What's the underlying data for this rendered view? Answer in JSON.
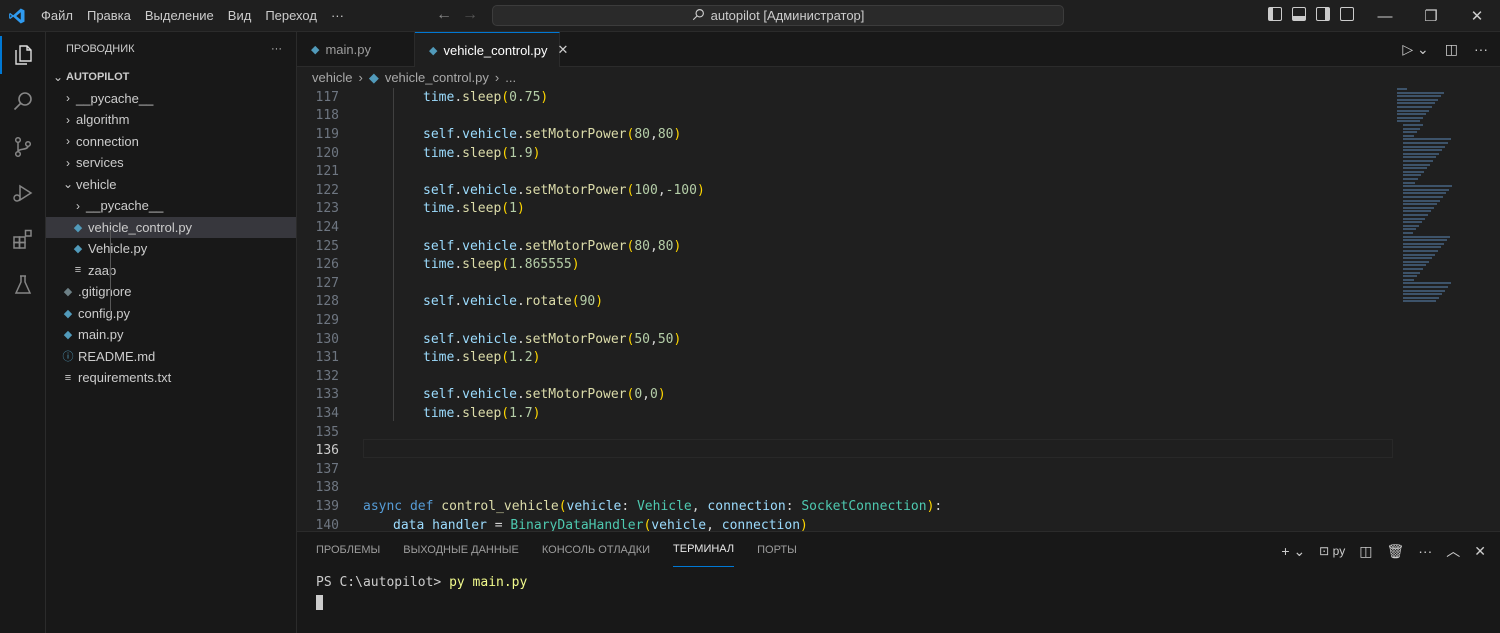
{
  "menu": [
    "Файл",
    "Правка",
    "Выделение",
    "Вид",
    "Переход",
    "···"
  ],
  "command_center": "autopilot [Администратор]",
  "explorer": {
    "title": "ПРОВОДНИК",
    "more": "···",
    "root": "AUTOPILOT",
    "items": [
      {
        "label": "__pycache__",
        "kind": "folder",
        "depth": 1
      },
      {
        "label": "algorithm",
        "kind": "folder",
        "depth": 1
      },
      {
        "label": "connection",
        "kind": "folder",
        "depth": 1
      },
      {
        "label": "services",
        "kind": "folder",
        "depth": 1
      },
      {
        "label": "vehicle",
        "kind": "folder-open",
        "depth": 1
      },
      {
        "label": "__pycache__",
        "kind": "folder",
        "depth": 2
      },
      {
        "label": "vehicle_control.py",
        "kind": "python",
        "depth": 2,
        "selected": true
      },
      {
        "label": "Vehicle.py",
        "kind": "python",
        "depth": 2
      },
      {
        "label": "zaap",
        "kind": "text",
        "depth": 2
      },
      {
        "label": ".gitignore",
        "kind": "git",
        "depth": 1
      },
      {
        "label": "config.py",
        "kind": "python",
        "depth": 1
      },
      {
        "label": "main.py",
        "kind": "python",
        "depth": 1
      },
      {
        "label": "README.md",
        "kind": "info",
        "depth": 1
      },
      {
        "label": "requirements.txt",
        "kind": "text",
        "depth": 1
      }
    ]
  },
  "tabs": [
    {
      "label": "main.py",
      "active": false
    },
    {
      "label": "vehicle_control.py",
      "active": true
    }
  ],
  "breadcrumb": {
    "folder": "vehicle",
    "file": "vehicle_control.py",
    "more": "..."
  },
  "code": {
    "current_line": 136,
    "lines": [
      {
        "n": 117,
        "indent": 2,
        "tokens": [
          [
            "var",
            "time"
          ],
          [
            "plain",
            "."
          ],
          [
            "fn",
            "sleep"
          ],
          [
            "paren",
            "("
          ],
          [
            "num",
            "0.75"
          ],
          [
            "paren",
            ")"
          ]
        ]
      },
      {
        "n": 118,
        "indent": 0,
        "tokens": []
      },
      {
        "n": 119,
        "indent": 2,
        "tokens": [
          [
            "var",
            "self"
          ],
          [
            "plain",
            "."
          ],
          [
            "var",
            "vehicle"
          ],
          [
            "plain",
            "."
          ],
          [
            "fn",
            "setMotorPower"
          ],
          [
            "paren",
            "("
          ],
          [
            "num",
            "80"
          ],
          [
            "plain",
            ","
          ],
          [
            "num",
            "80"
          ],
          [
            "paren",
            ")"
          ]
        ]
      },
      {
        "n": 120,
        "indent": 2,
        "tokens": [
          [
            "var",
            "time"
          ],
          [
            "plain",
            "."
          ],
          [
            "fn",
            "sleep"
          ],
          [
            "paren",
            "("
          ],
          [
            "num",
            "1.9"
          ],
          [
            "paren",
            ")"
          ]
        ]
      },
      {
        "n": 121,
        "indent": 0,
        "tokens": []
      },
      {
        "n": 122,
        "indent": 2,
        "tokens": [
          [
            "var",
            "self"
          ],
          [
            "plain",
            "."
          ],
          [
            "var",
            "vehicle"
          ],
          [
            "plain",
            "."
          ],
          [
            "fn",
            "setMotorPower"
          ],
          [
            "paren",
            "("
          ],
          [
            "num",
            "100"
          ],
          [
            "plain",
            ","
          ],
          [
            "num",
            "-100"
          ],
          [
            "paren",
            ")"
          ]
        ]
      },
      {
        "n": 123,
        "indent": 2,
        "tokens": [
          [
            "var",
            "time"
          ],
          [
            "plain",
            "."
          ],
          [
            "fn",
            "sleep"
          ],
          [
            "paren",
            "("
          ],
          [
            "num",
            "1"
          ],
          [
            "paren",
            ")"
          ]
        ]
      },
      {
        "n": 124,
        "indent": 0,
        "tokens": []
      },
      {
        "n": 125,
        "indent": 2,
        "tokens": [
          [
            "var",
            "self"
          ],
          [
            "plain",
            "."
          ],
          [
            "var",
            "vehicle"
          ],
          [
            "plain",
            "."
          ],
          [
            "fn",
            "setMotorPower"
          ],
          [
            "paren",
            "("
          ],
          [
            "num",
            "80"
          ],
          [
            "plain",
            ","
          ],
          [
            "num",
            "80"
          ],
          [
            "paren",
            ")"
          ]
        ]
      },
      {
        "n": 126,
        "indent": 2,
        "tokens": [
          [
            "var",
            "time"
          ],
          [
            "plain",
            "."
          ],
          [
            "fn",
            "sleep"
          ],
          [
            "paren",
            "("
          ],
          [
            "num",
            "1.865555"
          ],
          [
            "paren",
            ")"
          ]
        ]
      },
      {
        "n": 127,
        "indent": 0,
        "tokens": []
      },
      {
        "n": 128,
        "indent": 2,
        "tokens": [
          [
            "var",
            "self"
          ],
          [
            "plain",
            "."
          ],
          [
            "var",
            "vehicle"
          ],
          [
            "plain",
            "."
          ],
          [
            "fn",
            "rotate"
          ],
          [
            "paren",
            "("
          ],
          [
            "num",
            "90"
          ],
          [
            "paren",
            ")"
          ]
        ]
      },
      {
        "n": 129,
        "indent": 0,
        "tokens": []
      },
      {
        "n": 130,
        "indent": 2,
        "tokens": [
          [
            "var",
            "self"
          ],
          [
            "plain",
            "."
          ],
          [
            "var",
            "vehicle"
          ],
          [
            "plain",
            "."
          ],
          [
            "fn",
            "setMotorPower"
          ],
          [
            "paren",
            "("
          ],
          [
            "num",
            "50"
          ],
          [
            "plain",
            ","
          ],
          [
            "num",
            "50"
          ],
          [
            "paren",
            ")"
          ]
        ]
      },
      {
        "n": 131,
        "indent": 2,
        "tokens": [
          [
            "var",
            "time"
          ],
          [
            "plain",
            "."
          ],
          [
            "fn",
            "sleep"
          ],
          [
            "paren",
            "("
          ],
          [
            "num",
            "1.2"
          ],
          [
            "paren",
            ")"
          ]
        ]
      },
      {
        "n": 132,
        "indent": 0,
        "tokens": []
      },
      {
        "n": 133,
        "indent": 2,
        "tokens": [
          [
            "var",
            "self"
          ],
          [
            "plain",
            "."
          ],
          [
            "var",
            "vehicle"
          ],
          [
            "plain",
            "."
          ],
          [
            "fn",
            "setMotorPower"
          ],
          [
            "paren",
            "("
          ],
          [
            "num",
            "0"
          ],
          [
            "plain",
            ","
          ],
          [
            "num",
            "0"
          ],
          [
            "paren",
            ")"
          ]
        ]
      },
      {
        "n": 134,
        "indent": 2,
        "tokens": [
          [
            "var",
            "time"
          ],
          [
            "plain",
            "."
          ],
          [
            "fn",
            "sleep"
          ],
          [
            "paren",
            "("
          ],
          [
            "num",
            "1.7"
          ],
          [
            "paren",
            ")"
          ]
        ]
      },
      {
        "n": 135,
        "indent": 0,
        "tokens": []
      },
      {
        "n": 136,
        "indent": 0,
        "tokens": []
      },
      {
        "n": 137,
        "indent": 0,
        "tokens": []
      },
      {
        "n": 138,
        "indent": 0,
        "tokens": []
      },
      {
        "n": 139,
        "indent": 0,
        "tokens": [
          [
            "kw",
            "async"
          ],
          [
            "plain",
            " "
          ],
          [
            "kw",
            "def"
          ],
          [
            "plain",
            " "
          ],
          [
            "fn",
            "control_vehicle"
          ],
          [
            "paren",
            "("
          ],
          [
            "var",
            "vehicle"
          ],
          [
            "plain",
            ": "
          ],
          [
            "cls",
            "Vehicle"
          ],
          [
            "plain",
            ", "
          ],
          [
            "var",
            "connection"
          ],
          [
            "plain",
            ": "
          ],
          [
            "cls",
            "SocketConnection"
          ],
          [
            "paren",
            ")"
          ],
          [
            "plain",
            ":"
          ]
        ]
      },
      {
        "n": 140,
        "indent": 1,
        "tokens": [
          [
            "var",
            "data_handler"
          ],
          [
            "plain",
            " = "
          ],
          [
            "cls",
            "BinaryDataHandler"
          ],
          [
            "paren",
            "("
          ],
          [
            "var",
            "vehicle"
          ],
          [
            "plain",
            ", "
          ],
          [
            "var",
            "connection"
          ],
          [
            "paren",
            ")"
          ]
        ]
      }
    ]
  },
  "panel": {
    "tabs": [
      {
        "label": "ПРОБЛЕМЫ",
        "active": false
      },
      {
        "label": "ВЫХОДНЫЕ ДАННЫЕ",
        "active": false
      },
      {
        "label": "КОНСОЛЬ ОТЛАДКИ",
        "active": false
      },
      {
        "label": "ТЕРМИНАЛ",
        "active": true
      },
      {
        "label": "ПОРТЫ",
        "active": false
      }
    ],
    "shell_label": "py",
    "prompt": "PS C:\\autopilot>",
    "command": "py main.py"
  },
  "colors": {
    "accent": "#0078d4",
    "python_icon": "#519aba"
  }
}
